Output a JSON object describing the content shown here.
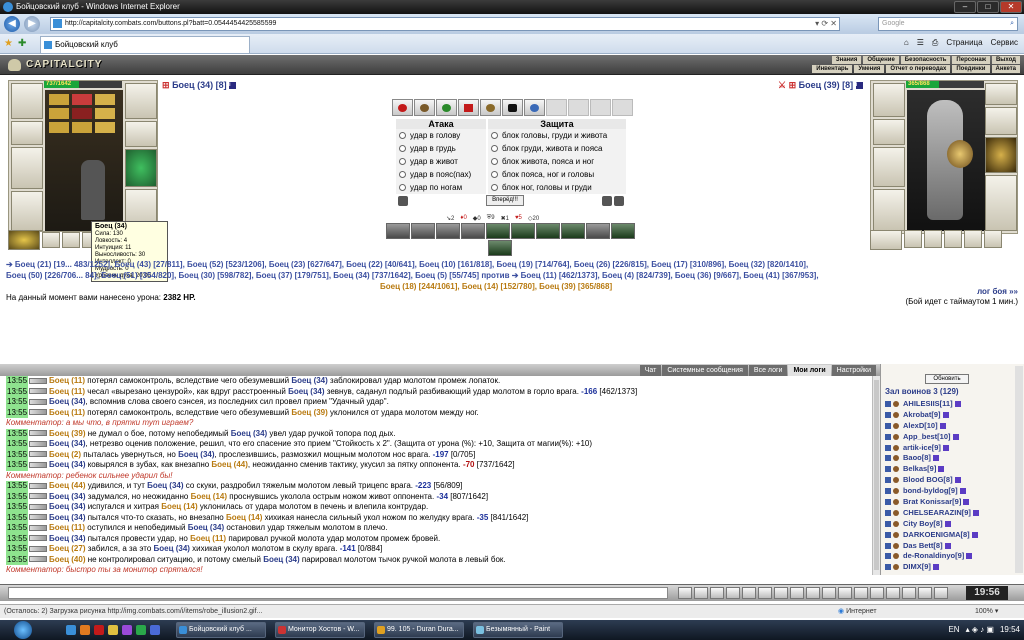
{
  "window": {
    "title": "Бойцовский клуб - Windows Internet Explorer"
  },
  "browser": {
    "url": "http://capitalcity.combats.com/buttons.pl?batt=0.0544454425585599",
    "search_placeholder": "Google",
    "tab_title": "Бойцовский клуб",
    "tools": [
      "Страница",
      "Сервис"
    ]
  },
  "game": {
    "logo": "CAPITALCITY",
    "menu_row1": [
      "Знания",
      "Общение",
      "Безопасность",
      "Персонаж",
      "Выход"
    ],
    "menu_row2": [
      "Инвентарь",
      "Умения",
      "Отчет о переводах",
      "Поединки",
      "Анкета"
    ]
  },
  "left_fighter": {
    "name": "Боец (34) [8]",
    "hp_text": "737/1642",
    "hp_fraction": 0.449
  },
  "right_fighter": {
    "name": "Боец (39) [8]",
    "hp_text": "365/868",
    "hp_fraction": 0.42
  },
  "tooltip": {
    "title": "Боец (34)",
    "lines": [
      "Сила: 130",
      "Ловкость: 4",
      "Интуиция: 11",
      "Выносливость: 30",
      "Интеллект: 0",
      "Мудрость: 0",
      "Уровень духа: 20.00"
    ]
  },
  "combat": {
    "attack_header": "Атака",
    "defense_header": "Защита",
    "attacks": [
      "удар в голову",
      "удар в грудь",
      "удар в живот",
      "удар в пояс(пах)",
      "удар по ногам"
    ],
    "blocks": [
      "блок головы, груди и живота",
      "блок груди, живота и пояса",
      "блок живота, пояса и ног",
      "блок пояса, ног и головы",
      "блок ног, головы и груди"
    ],
    "fight_button": "Вперёд!!!",
    "stats": [
      "2",
      "0",
      "0",
      "9",
      "1",
      "5",
      "20"
    ]
  },
  "teams": {
    "line1": "➔ Боец (21) [19... 483/1252], Боец (43) [27/811], Боец (52) [523/1206], Боец (23) [627/647], Боец (22) [40/641], Боец (10) [161/818], Боец (19) [714/764], Боец (26) [226/815], Боец (17) [310/896], Боец (32) [820/1410],",
    "line2": "Боец (50) [226/706... 84], Боец (51) [354/820], Боец (30) [598/782], Боец (37) [179/751], Боец (34) [737/1642], Боец (5) [55/745]  против  ➔ Боец (11) [462/1373], Боец (4) [824/739], Боец (36) [9/667], Боец (41) [367/953],",
    "line3": "Боец (18) [244/1061], Боец (14) [152/780], Боец (39) [365/868]"
  },
  "damage": {
    "label": "На данный момент вами нанесено урона:",
    "value": "2382 HP."
  },
  "lognav": {
    "link": "лог боя »»",
    "timeout": "(Бой идет с таймаутом 1 мин.)"
  },
  "chat_tabs": [
    "Чат",
    "Системные сообщения",
    "Все логи",
    "Мои логи",
    "Настройки"
  ],
  "log": [
    {
      "t": "13:55",
      "a": "Боец (11)",
      "a2": "u2",
      "txt": " потерял самоконтроль, вследствие чего обезумевший ",
      "b": "Боец (34)",
      "b2": "u1",
      "tail": " заблокировал удар молотом промеж лопаток.",
      "v": "",
      "c": ""
    },
    {
      "t": "13:55",
      "a": "Боец (11)",
      "a2": "u2",
      "txt": " чесал «вырезано цензурой», как вдруг расстроенный ",
      "b": "Боец (34)",
      "b2": "u1",
      "tail": " зевнув, саданул подлый разбивающий удар молотом в горло врага. ",
      "v": "-166",
      "c": " [462/1373]"
    },
    {
      "t": "13:55",
      "a": "Боец (34)",
      "a2": "u1",
      "txt": ", вспомнив слова своего сэнсея, из последних сил провел прием ",
      "b": "",
      "b2": "",
      "tail": "\"Удачный удар\".",
      "v": "",
      "c": ""
    },
    {
      "t": "13:55",
      "a": "Боец (11)",
      "a2": "u2",
      "txt": " потерял самоконтроль, вследствие чего обезумевший ",
      "b": "Боец (39)",
      "b2": "u2",
      "tail": " уклонился от удара молотом между ног.",
      "v": "",
      "c": ""
    },
    {
      "comment": "Комментатор: а мы что, в прятки тут играем?"
    },
    {
      "t": "13:55",
      "a": "Боец (39)",
      "a2": "u2",
      "txt": " не думал о бое, потому непобедимый ",
      "b": "Боец (34)",
      "b2": "u1",
      "tail": " увел удар ручкой топора под дых.",
      "v": "",
      "c": ""
    },
    {
      "t": "13:55",
      "a": "Боец (34)",
      "a2": "u1",
      "txt": ", нетрезво оценив положение, решил, что его спасение это прием ",
      "b": "",
      "b2": "",
      "tail": "\"Стойкость x 2\". (Защита от урона (%): +10, Защита от магии(%): +10)",
      "v": "",
      "c": ""
    },
    {
      "t": "13:55",
      "a": "Боец (2)",
      "a2": "u2",
      "txt": " пыталась увернуться, но ",
      "b": "Боец (34)",
      "b2": "u1",
      "tail": ", прослезившись, размозжил мощным молотом нос врага. ",
      "v": "-197",
      "c": " [0/705]"
    },
    {
      "t": "13:55",
      "a": "Боец (34)",
      "a2": "u1",
      "txt": " ковырялся в зубах, как внезапно ",
      "b": "Боец (44)",
      "b2": "u2",
      "tail": ", неожиданно сменив тактику, укусил за пятку оппонента. ",
      "v": "-70",
      "c": " [737/1642]",
      "crit": true
    },
    {
      "comment": "Комментатор: ребенок сильнее ударил бы!"
    },
    {
      "t": "13:55",
      "a": "Боец (44)",
      "a2": "u2",
      "txt": " удивился, и тут ",
      "b": "Боец (34)",
      "b2": "u1",
      "tail": " со скуки, раздробил тяжелым молотом левый трицепс врага. ",
      "v": "-223",
      "c": " [56/809]"
    },
    {
      "t": "13:55",
      "a": "Боец (34)",
      "a2": "u1",
      "txt": " задумался, но неожиданно ",
      "b": "Боец (14)",
      "b2": "u2",
      "tail": " проснувшись уколола острым ножом живот оппонента. ",
      "v": "-34",
      "c": " [807/1642]"
    },
    {
      "t": "13:55",
      "a": "Боец (34)",
      "a2": "u1",
      "txt": " испугался и хитрая ",
      "b": "Боец (14)",
      "b2": "u2",
      "tail": " уклонилась от удара молотом в печень и влепила контрудар.",
      "v": "",
      "c": ""
    },
    {
      "t": "13:55",
      "a": "Боец (34)",
      "a2": "u1",
      "txt": " пытался что-то сказать, но внезапно ",
      "b": "Боец (14)",
      "b2": "u2",
      "tail": " хихикая нанесла сильный укол ножом по желудку врага. ",
      "v": "-35",
      "c": " [841/1642]"
    },
    {
      "t": "13:55",
      "a": "Боец (11)",
      "a2": "u2",
      "txt": " оступился и непобедимый ",
      "b": "Боец (34)",
      "b2": "u1",
      "tail": " остановил удар тяжелым молотом в плечо.",
      "v": "",
      "c": ""
    },
    {
      "t": "13:55",
      "a": "Боец (34)",
      "a2": "u1",
      "txt": " пытался провести удар, но ",
      "b": "Боец (11)",
      "b2": "u2",
      "tail": " парировал ручкой молота удар молотом промеж бровей.",
      "v": "",
      "c": ""
    },
    {
      "t": "13:55",
      "a": "Боец (27)",
      "a2": "u2",
      "txt": " забился, а за это ",
      "b": "Боец (34)",
      "b2": "u1",
      "tail": " хихикая уколол молотом в скулу врага. ",
      "v": "-141",
      "c": " [0/884]"
    },
    {
      "t": "13:55",
      "a": "Боец (40)",
      "a2": "u2",
      "txt": " не контролировал ситуацию, и потому смелый ",
      "b": "Боец (34)",
      "b2": "u1",
      "tail": " парировал молотом тычок ручкой молота в левый бок.",
      "v": "",
      "c": ""
    },
    {
      "comment": "Комментатор: быстро ты за монитор спрятался!"
    }
  ],
  "users": {
    "refresh": "Обновить",
    "place": "Зал воинов 3 (129)",
    "list": [
      "AHILESIIS[11]",
      "Akrobat[9]",
      "AlexD[10]",
      "App_best[10]",
      "artik-ice[9]",
      "Baoo[8]",
      "Belkas[9]",
      "Blood BOG[8]",
      "bond-byldog[9]",
      "Brat Konissar[9]",
      "CHELSEARAZIN[9]",
      "City Boy[8]",
      "DARKOENIGMA[8]",
      "Das Bett[8]",
      "de-Ronaldinyo[9]",
      "DIMX[9]"
    ]
  },
  "clock": "19:56",
  "statusbar": {
    "text": "(Осталось: 2) Загрузка рисунка http://img.combats.com/i/items/robe_illusion2.gif...",
    "zone": "Интернет",
    "zoom": "100%"
  },
  "taskbar": {
    "tasks": [
      "Бойцовский клуб ...",
      "Монитор Хостов - W...",
      "99. 105 - Duran Dura...",
      "Безымянный - Paint"
    ],
    "tray_lang": "EN",
    "time": "19:54"
  }
}
